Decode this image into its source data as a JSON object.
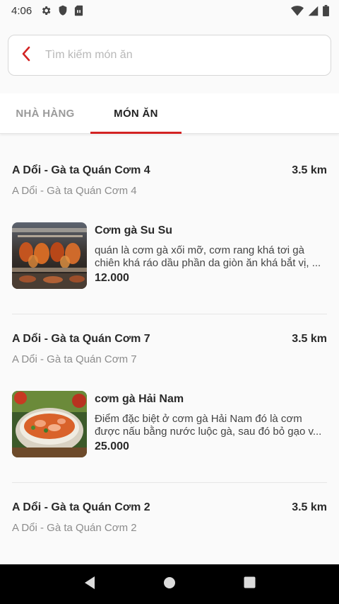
{
  "status_bar": {
    "time": "4:06",
    "icons_left": [
      "gear-icon",
      "shield-icon",
      "sim-card-icon"
    ],
    "icons_right": [
      "wifi-icon",
      "cellular-signal-icon",
      "battery-icon"
    ]
  },
  "search": {
    "placeholder": "Tìm kiếm món ăn",
    "value": ""
  },
  "tabs": [
    {
      "label": "NHÀ HÀNG",
      "selected": false
    },
    {
      "label": "MÓN ĂN",
      "selected": true
    }
  ],
  "accent_color": "#d32323",
  "results": [
    {
      "restaurant": "A Dổi - Gà ta Quán Cơm 4",
      "subtitle": "A Dổi - Gà ta Quán Cơm 4",
      "distance": "3.5 km",
      "dish": {
        "name": "Cơm gà Su Su",
        "description": "quán là cơm gà xối mỡ, cơm rang khá tơi gà chiên khá ráo dầu phần da giòn ăn khá bắt vị, ...",
        "price": "12.000",
        "image": "rotisserie-chicken-photo"
      }
    },
    {
      "restaurant": "A Dổi - Gà ta Quán Cơm 7",
      "subtitle": "A Dổi - Gà ta Quán Cơm 7",
      "distance": "3.5 km",
      "dish": {
        "name": "cơm gà Hải Nam",
        "description": "Điểm đặc biệt ở cơm gà Hải Nam đó là cơm được nấu bằng nước luộc gà, sau đó bỏ gạo v...",
        "price": "25.000",
        "image": "spicy-soup-bowl-photo"
      }
    },
    {
      "restaurant": "A Dổi - Gà ta Quán Cơm 2",
      "subtitle": "A Dổi - Gà ta Quán Cơm 2",
      "distance": "3.5 km"
    }
  ],
  "nav_bar": [
    "back-triangle-icon",
    "home-circle-icon",
    "recents-square-icon"
  ]
}
